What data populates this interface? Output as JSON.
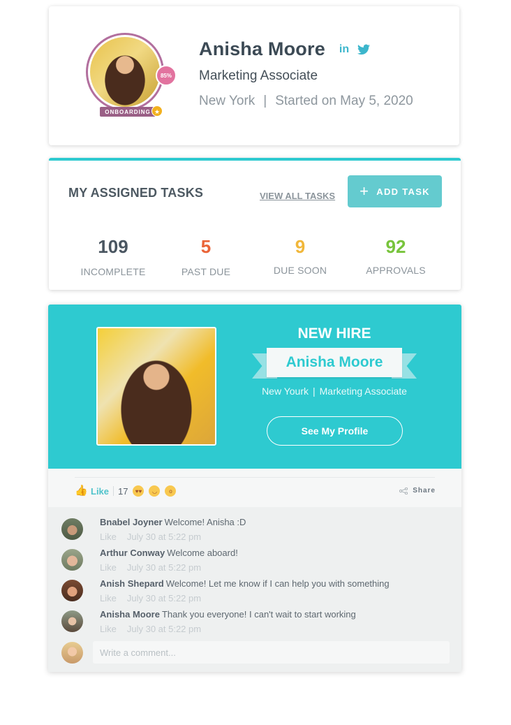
{
  "profile": {
    "name": "Anisha Moore",
    "title": "Marketing Associate",
    "location": "New York",
    "separator": "|",
    "start_date": "Started on May 5, 2020",
    "completion_badge": "85%",
    "status_badge": "ONBOARDING",
    "star_icon": "★",
    "linkedin_label": "in",
    "social_icons": [
      "linkedin-icon",
      "twitter-icon"
    ],
    "ring_color": "#b26f9e"
  },
  "tasks": {
    "title": "MY ASSIGNED TASKS",
    "view_all_label": "VIEW ALL TASKS",
    "add_task_label": "ADD TASK",
    "add_icon": "+",
    "stats": [
      {
        "value": "109",
        "label": "INCOMPLETE",
        "color": "#4a5661"
      },
      {
        "value": "5",
        "label": "PAST DUE",
        "color": "#ea6438"
      },
      {
        "value": "9",
        "label": "DUE SOON",
        "color": "#f1b73a"
      },
      {
        "value": "92",
        "label": "APPROVALS",
        "color": "#78c43c"
      }
    ],
    "accent_color": "#2ecad0"
  },
  "new_hire": {
    "heading": "NEW HIRE",
    "name": "Anisha Moore",
    "location": "New Yourk",
    "separator": "|",
    "title": "Marketing Associate",
    "profile_button": "See My Profile",
    "banner_color": "#2ecad0"
  },
  "reactions": {
    "like_label": "Like",
    "count": "17",
    "emojis": [
      "heart-eyes-emoji",
      "tongue-emoji",
      "surprised-emoji"
    ],
    "share_label": "Share"
  },
  "comments": [
    {
      "author": "Bnabel Joyner",
      "text": "Welcome! Anisha :D",
      "like": "Like",
      "time": "July 30 at 5:22 pm",
      "avatar_color": "#7a8a6e"
    },
    {
      "author": "Arthur Conway",
      "text": "Welcome aboard!",
      "like": "Like",
      "time": "July 30 at 5:22 pm",
      "avatar_color": "#9aa58a"
    },
    {
      "author": "Anish Shepard",
      "text": "Welcome! Let me know if I can help you with something",
      "like": "Like",
      "time": "July 30 at 5:22 pm",
      "avatar_color": "#a86a4e"
    },
    {
      "author": "Anisha Moore",
      "text": "Thank you everyone! I can't wait to start working",
      "like": "Like",
      "time": "July 30 at 5:22 pm",
      "avatar_color": "#8a7a66"
    }
  ],
  "comment_input": {
    "placeholder": "Write a comment...",
    "value": ""
  }
}
